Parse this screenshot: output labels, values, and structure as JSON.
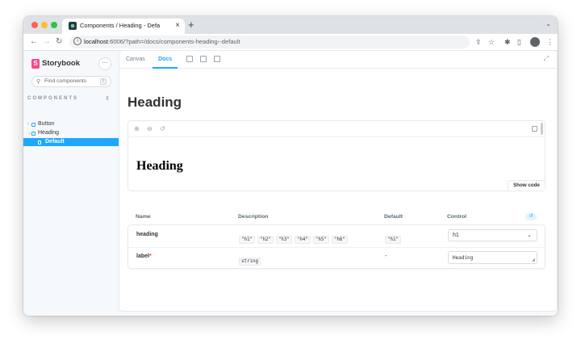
{
  "browser": {
    "tab_title": "Components / Heading - Defa",
    "url_host": "localhost",
    "url_rest": ":6006/?path=/docs/components-heading--default"
  },
  "sidebar": {
    "brand": "Storybook",
    "search_placeholder": "Find components",
    "search_shortcut": "/",
    "section_label": "COMPONENTS",
    "items": [
      {
        "label": "Button"
      },
      {
        "label": "Heading"
      },
      {
        "label": "Default"
      }
    ]
  },
  "panel": {
    "tabs": [
      {
        "label": "Canvas"
      },
      {
        "label": "Docs"
      }
    ]
  },
  "docs": {
    "title": "Heading",
    "preview_heading": "Heading",
    "show_code": "Show code"
  },
  "args_table": {
    "headers": {
      "name": "Name",
      "description": "Description",
      "default": "Default",
      "control": "Control"
    },
    "rows": [
      {
        "name": "heading",
        "options": [
          "\"h1\"",
          "\"h2\"",
          "\"h3\"",
          "\"h4\"",
          "\"h5\"",
          "\"h6\""
        ],
        "default": "\"h1\"",
        "control_value": "h1"
      },
      {
        "name": "label",
        "required_mark": "*",
        "type": "string",
        "default": "-",
        "control_value": "Heading"
      }
    ]
  },
  "colors": {
    "accent": "#1ea7fd",
    "brand": "#ff4785",
    "sidebar_bg": "#f6f9fc"
  }
}
